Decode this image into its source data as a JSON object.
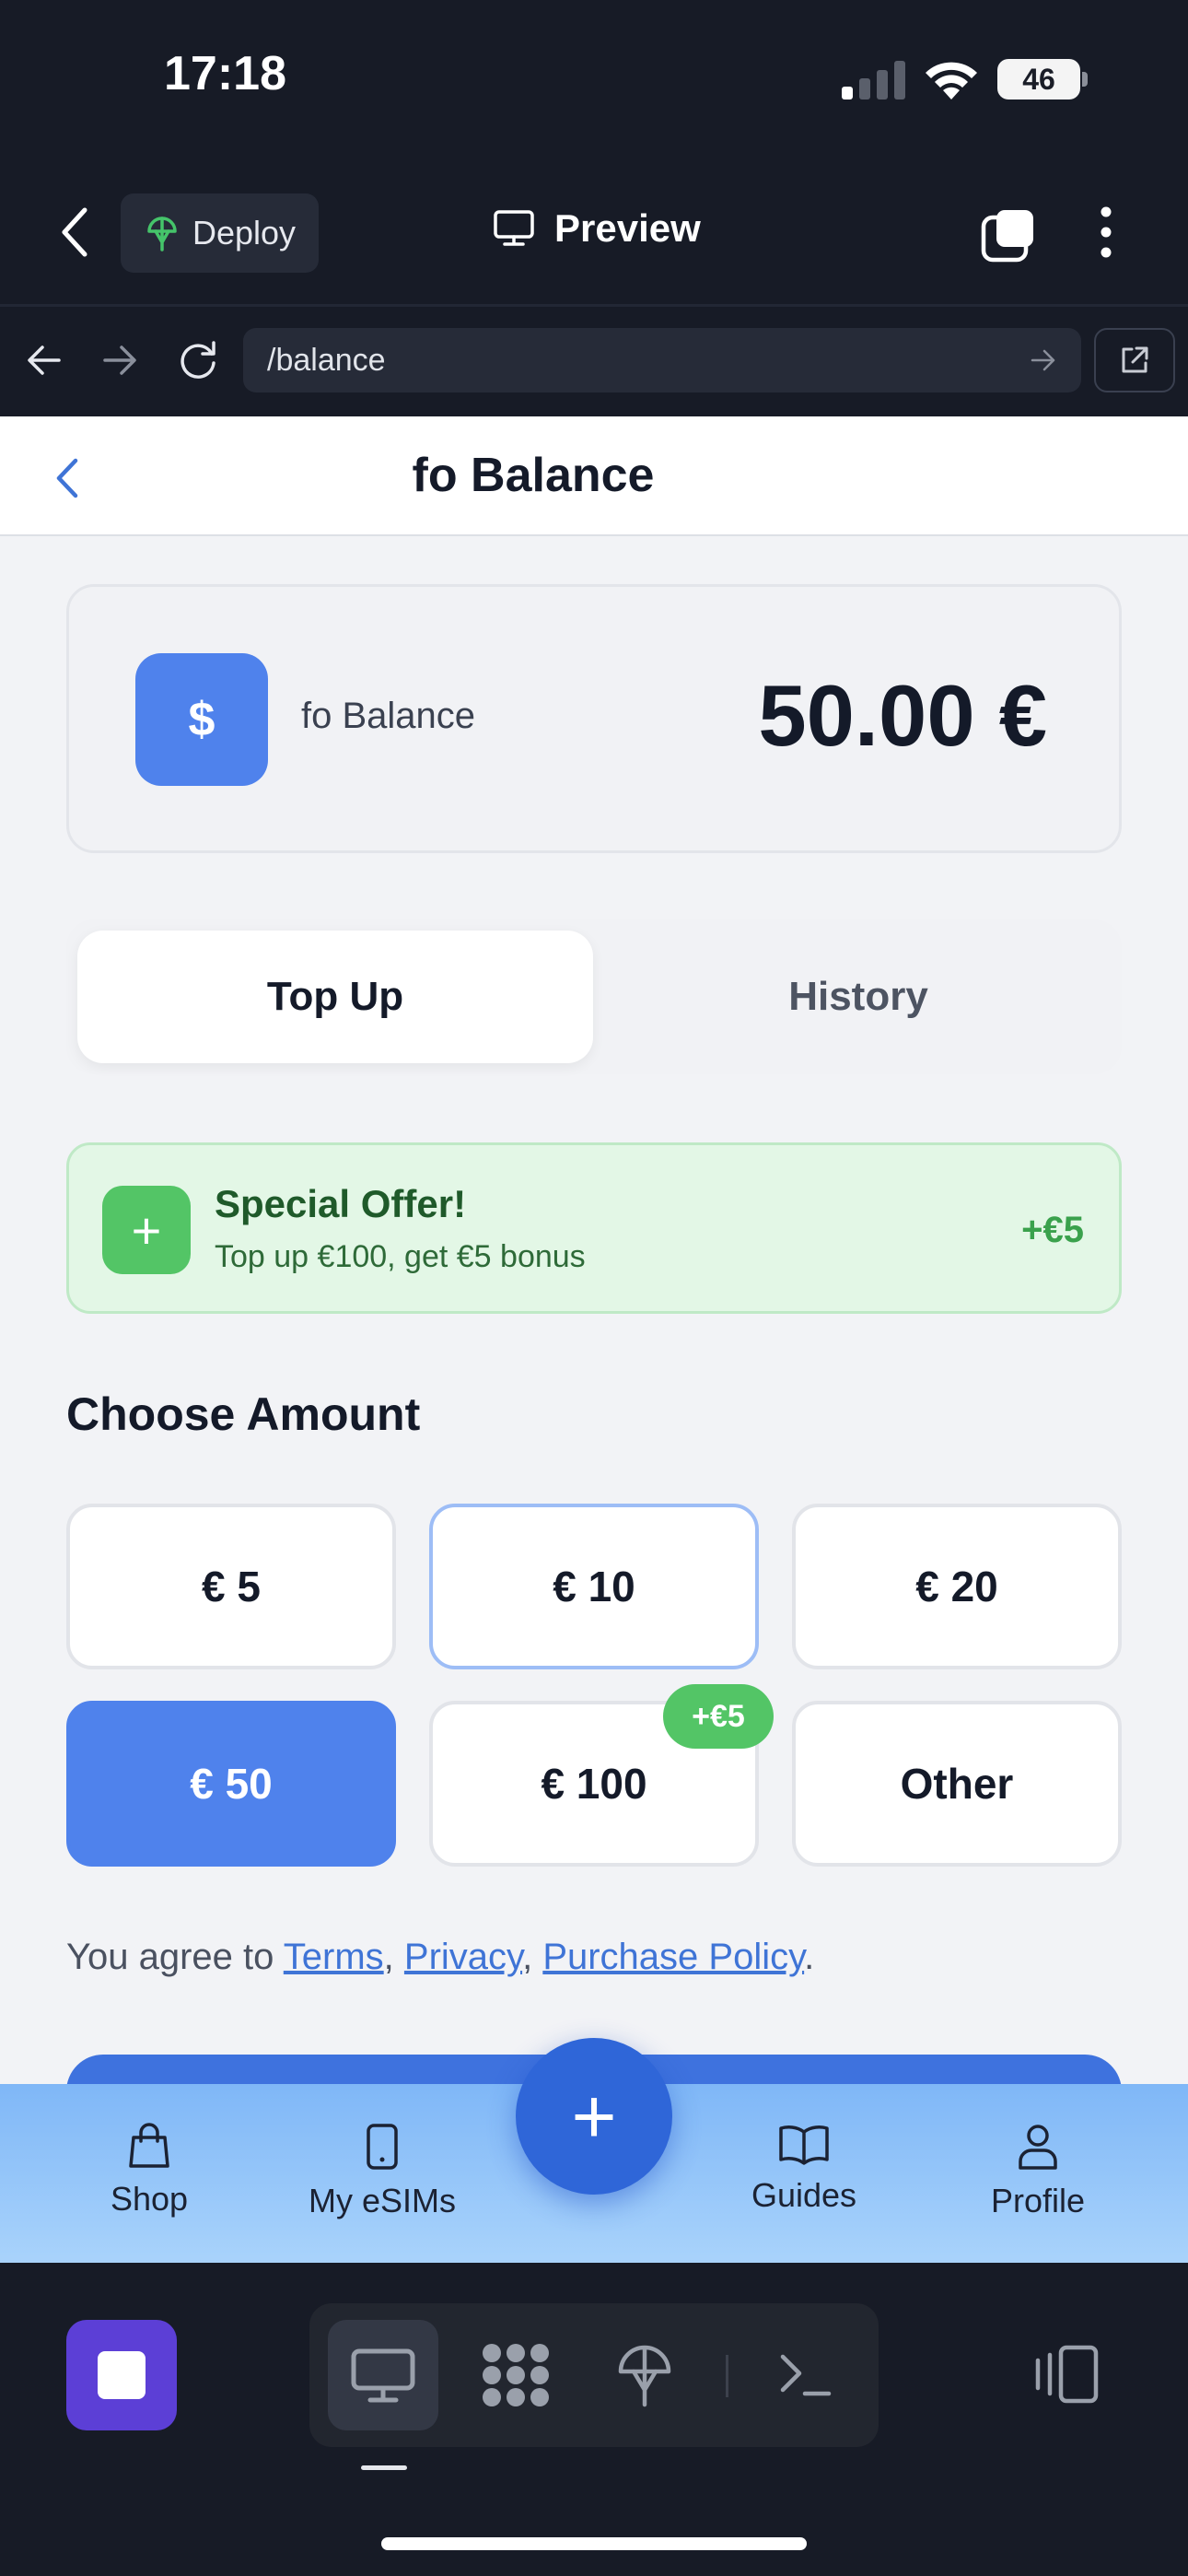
{
  "status_bar": {
    "time": "17:18",
    "battery": "46"
  },
  "app_bar": {
    "deploy_label": "Deploy",
    "preview_label": "Preview"
  },
  "browser": {
    "url": "/balance"
  },
  "page": {
    "title": "fo Balance",
    "balance_card": {
      "label": "fo Balance",
      "amount": "50.00 €",
      "icon_symbol": "$"
    },
    "segments": {
      "active": "Top Up",
      "inactive": "History"
    },
    "offer": {
      "title": "Special Offer!",
      "subtitle": "Top up €100, get €5 bonus",
      "bonus": "+€5",
      "plus_symbol": "+"
    },
    "choose_amount_title": "Choose Amount",
    "amounts": [
      {
        "label": "€ 5"
      },
      {
        "label": "€ 10"
      },
      {
        "label": "€ 20"
      },
      {
        "label": "€ 50"
      },
      {
        "label": "€ 100",
        "badge": "+€5"
      },
      {
        "label": "Other"
      }
    ],
    "selected_amount": "€ 50",
    "agreement": {
      "prefix": "You agree to ",
      "terms": "Terms",
      "sep1": ", ",
      "privacy": "Privacy",
      "sep2": ", ",
      "purchase_policy": "Purchase Policy",
      "suffix": "."
    }
  },
  "tab_bar": {
    "tabs": [
      {
        "label": "Shop",
        "icon": "shopping-bag-icon"
      },
      {
        "label": "My eSIMs",
        "icon": "phone-icon"
      },
      {
        "label": "Guides",
        "icon": "book-icon"
      },
      {
        "label": "Profile",
        "icon": "person-icon"
      }
    ],
    "fab_symbol": "+"
  },
  "colors": {
    "accent": "#4f82ec",
    "offer_green": "#53c566",
    "ide_purple": "#5c3fd6",
    "dark_bg": "#171b26"
  }
}
